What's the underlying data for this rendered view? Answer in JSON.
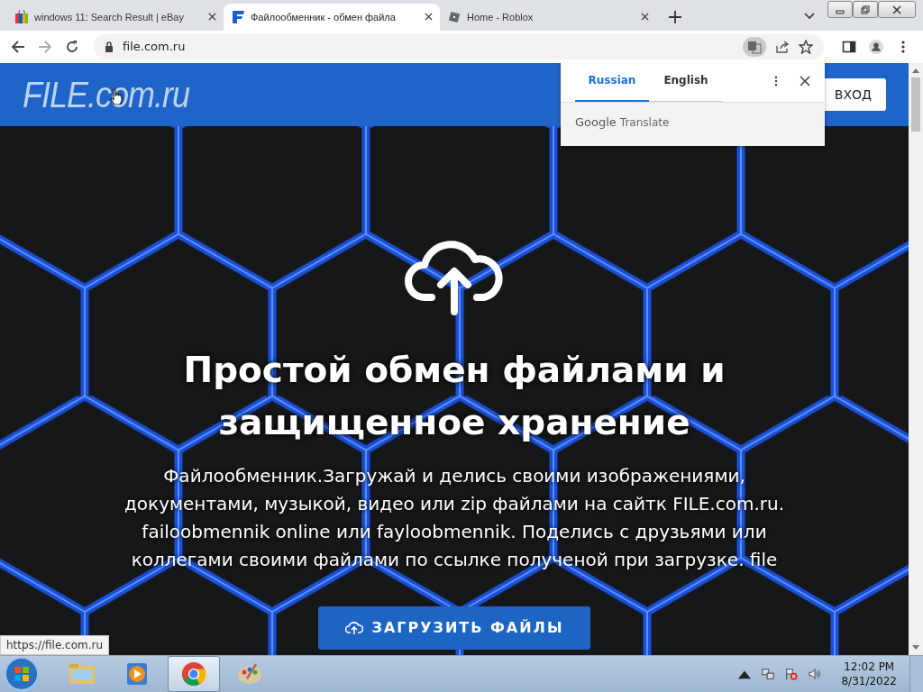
{
  "browser": {
    "tabs": [
      {
        "title": "windows 11: Search Result | eBay",
        "kind": "ebay",
        "selected": false
      },
      {
        "title": "Файлообменник - обмен файла",
        "kind": "file",
        "selected": true
      },
      {
        "title": "Home - Roblox",
        "kind": "roblox",
        "selected": false
      }
    ],
    "address": "file.com.ru",
    "translate_popup": {
      "languages": [
        {
          "label": "Russian",
          "selected": true
        },
        {
          "label": "English",
          "selected": false
        }
      ],
      "brand": "Google",
      "product": "Translate"
    },
    "status_url": "https://file.com.ru"
  },
  "page": {
    "logo": "FILE.com.ru",
    "login_button": "ВХОД",
    "heading": "Простой обмен файлами и защищенное хранение",
    "description": "Файлообменник.Загружай и делись своими изображениями, документами, музыкой, видео или zip файлами на сайтк FILE.com.ru. failoobmennik online или fayloobmennik. Поделись с друзьями или коллегами своими файлами по ссылке полученой при загрузке. file",
    "upload_button": "ЗАГРУЗИТЬ ФАЙЛЫ"
  },
  "taskbar": {
    "apps": [
      {
        "kind": "explorer",
        "selected": false
      },
      {
        "kind": "media",
        "selected": false
      },
      {
        "kind": "chrome",
        "selected": true
      },
      {
        "kind": "paint",
        "selected": false
      }
    ],
    "time": "12:02 PM",
    "date": "8/31/2022"
  }
}
